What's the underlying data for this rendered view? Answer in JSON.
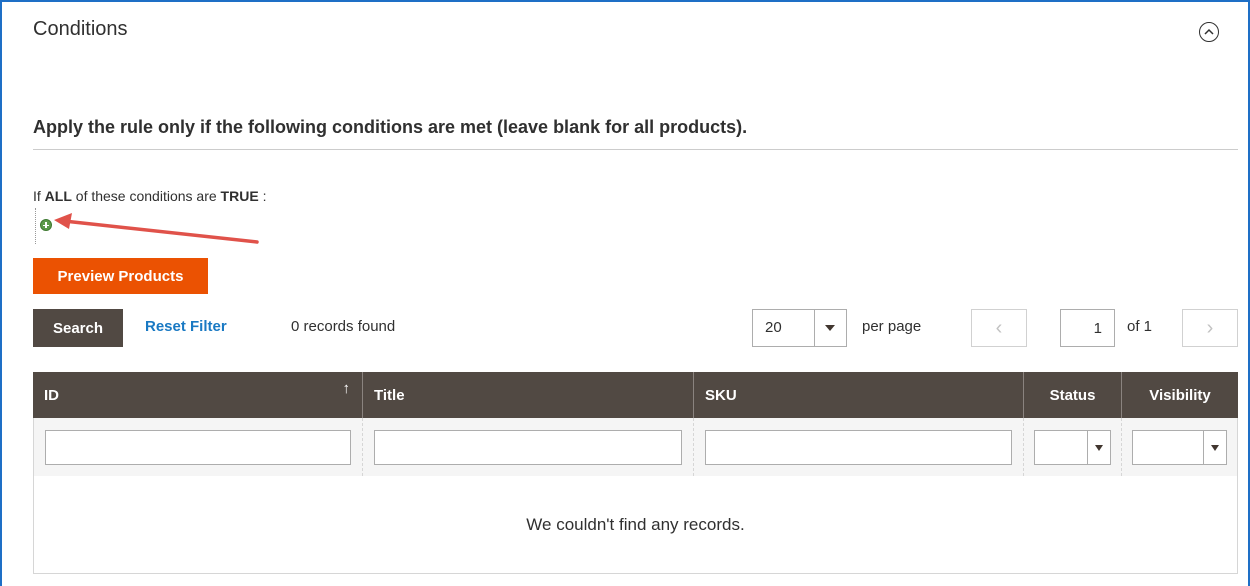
{
  "section": {
    "title": "Conditions"
  },
  "conditions": {
    "heading": "Apply the rule only if the following conditions are met (leave blank for all products).",
    "prefix": "If",
    "aggregator": "ALL",
    "middle": "of these conditions are",
    "value": "TRUE",
    "suffix": ":"
  },
  "actions": {
    "preview_label": "Preview Products",
    "search_label": "Search",
    "reset_label": "Reset Filter",
    "records_found": "0 records found"
  },
  "pager": {
    "per_page_value": "20",
    "per_page_label": "per page",
    "current_page": "1",
    "of_label": "of 1",
    "prev_glyph": "‹",
    "next_glyph": "›"
  },
  "grid": {
    "columns": [
      {
        "label": "ID",
        "sorted": "ascending"
      },
      {
        "label": "Title"
      },
      {
        "label": "SKU"
      },
      {
        "label": "Status"
      },
      {
        "label": "Visibility"
      }
    ],
    "sort_glyph": "↑",
    "empty_message": "We couldn't find any records."
  },
  "colors": {
    "accent_orange": "#eb5202",
    "header_dark": "#514943",
    "link_blue": "#1979c3",
    "arrow_red": "#e0524a",
    "frame_blue": "#1e6fc6"
  },
  "icons": {
    "collapse": "chevron-up-icon",
    "add_condition": "plus-circle-icon"
  }
}
